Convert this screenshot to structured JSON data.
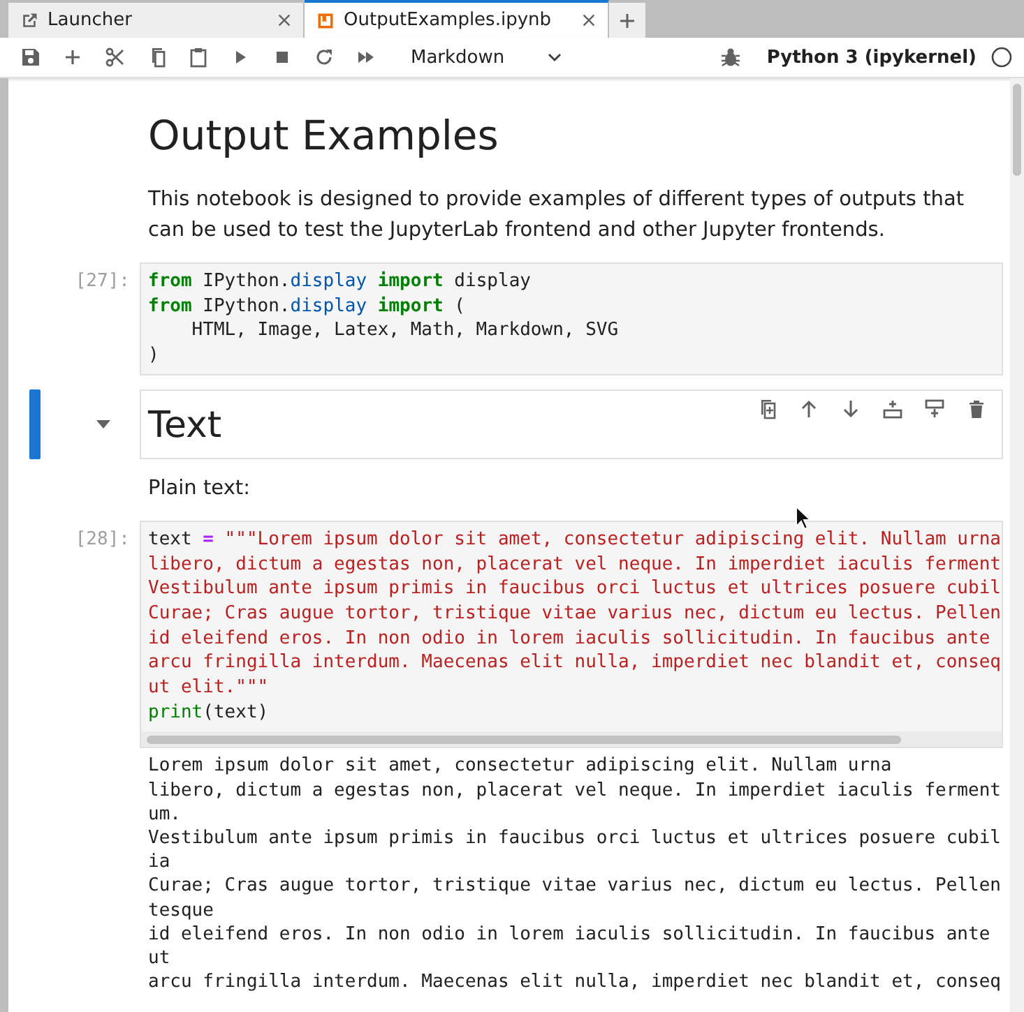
{
  "tabs": [
    {
      "label": "Launcher",
      "kind": "launcher",
      "selected": false
    },
    {
      "label": "OutputExamples.ipynb",
      "kind": "notebook",
      "selected": true
    }
  ],
  "toolbar": {
    "cell_type": "Markdown",
    "kernel": "Python 3 (ipykernel)"
  },
  "cells": [
    {
      "kind": "markdown",
      "selected": false,
      "blocks": [
        {
          "kind": "h1",
          "text": "Output Examples"
        },
        {
          "kind": "p",
          "text": "This notebook is designed to provide examples of different types of outputs that can be used to test the JupyterLab frontend and other Jupyter frontends."
        }
      ]
    },
    {
      "kind": "code",
      "selected": false,
      "prompt": "[27]:",
      "lines": [
        [
          {
            "kind": "kw",
            "s": "from"
          },
          {
            "kind": "plain",
            "s": " IPython."
          },
          {
            "kind": "mod",
            "s": "display"
          },
          {
            "kind": "kw",
            "s": " import"
          },
          {
            "kind": "plain",
            "s": " display"
          }
        ],
        [
          {
            "kind": "kw",
            "s": "from"
          },
          {
            "kind": "plain",
            "s": " IPython."
          },
          {
            "kind": "mod",
            "s": "display"
          },
          {
            "kind": "kw",
            "s": " import"
          },
          {
            "kind": "plain",
            "s": " ("
          }
        ],
        [
          {
            "kind": "plain",
            "s": "    HTML, Image, Latex, Math, Markdown, SVG"
          }
        ],
        [
          {
            "kind": "plain",
            "s": ")"
          }
        ]
      ]
    },
    {
      "kind": "markdown",
      "selected": true,
      "blocks": [
        {
          "kind": "h2",
          "text": "Text"
        }
      ]
    },
    {
      "kind": "markdown",
      "selected": false,
      "blocks": [
        {
          "kind": "p",
          "text": "Plain text:"
        }
      ]
    },
    {
      "kind": "code",
      "selected": false,
      "prompt": "[28]:",
      "lines": [
        [
          {
            "kind": "plain",
            "s": "text "
          },
          {
            "kind": "op",
            "s": "="
          },
          {
            "kind": "str",
            "s": " \"\"\"Lorem ipsum dolor sit amet, consectetur adipiscing elit. Nullam urna"
          }
        ],
        [
          {
            "kind": "str",
            "s": "libero, dictum a egestas non, placerat vel neque. In imperdiet iaculis ferment"
          }
        ],
        [
          {
            "kind": "str",
            "s": "Vestibulum ante ipsum primis in faucibus orci luctus et ultrices posuere cubil"
          }
        ],
        [
          {
            "kind": "str",
            "s": "Curae; Cras augue tortor, tristique vitae varius nec, dictum eu lectus. Pellen"
          }
        ],
        [
          {
            "kind": "str",
            "s": "id eleifend eros. In non odio in lorem iaculis sollicitudin. In faucibus ante"
          }
        ],
        [
          {
            "kind": "str",
            "s": "arcu fringilla interdum. Maecenas elit nulla, imperdiet nec blandit et, conseq"
          }
        ],
        [
          {
            "kind": "str",
            "s": "ut elit.\"\"\""
          }
        ],
        [
          {
            "kind": "builtin",
            "s": "print"
          },
          {
            "kind": "plain",
            "s": "(text)"
          }
        ]
      ],
      "output": [
        "Lorem ipsum dolor sit amet, consectetur adipiscing elit. Nullam urna",
        "libero, dictum a egestas non, placerat vel neque. In imperdiet iaculis ferment",
        "um.",
        "Vestibulum ante ipsum primis in faucibus orci luctus et ultrices posuere cubil",
        "ia",
        "Curae; Cras augue tortor, tristique vitae varius nec, dictum eu lectus. Pellen",
        "tesque",
        "id eleifend eros. In non odio in lorem iaculis sollicitudin. In faucibus ante",
        "ut",
        "arcu fringilla interdum. Maecenas elit nulla, imperdiet nec blandit et, conseq"
      ]
    }
  ]
}
